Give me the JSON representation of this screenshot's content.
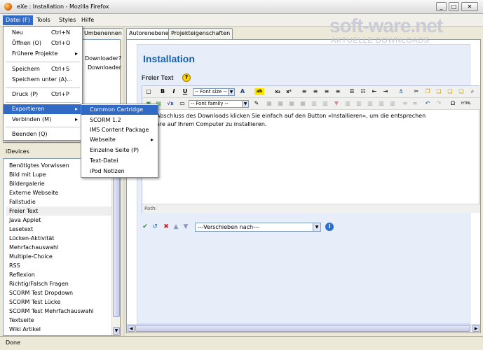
{
  "window": {
    "title": "eXe : Installation - Mozilla Firefox",
    "btn_min": "_",
    "btn_max": "□",
    "btn_close": "✕"
  },
  "menubar": [
    "Datei (F)",
    "Tools",
    "Styles",
    "Hilfe"
  ],
  "left_tabs": {
    "rename": "Umbenennen"
  },
  "outline": {
    "items": [
      "Downloader?",
      "Downloader"
    ]
  },
  "idevices": {
    "header": "iDevices",
    "items": [
      "Benötigtes Vorwissen",
      "Bild mit Lupe",
      "Bildergalerie",
      "Externe Webseite",
      "Fallstudie",
      "Freier Text",
      "Java Applet",
      "Lesetext",
      "Lücken-Aktivität",
      "Mehrfachauswahl",
      "Multiple-Choice",
      "RSS",
      "Reflexion",
      "Richtig/Falsch Fragen",
      "SCORM Test Dropdown",
      "SCORM Test Lücke",
      "SCORM Test Mehrfachauswahl",
      "Textseite",
      "Wiki Artikel"
    ]
  },
  "right_tabs": [
    "Autorenebene",
    "Projekteigenschaften"
  ],
  "page": {
    "title": "Installation",
    "block_title": "Freier Text",
    "help": "?"
  },
  "editor": {
    "font_size": "-- Font size --",
    "font_family": "-- Font family --",
    "text_line1": "Abschluss des Downloads klicken Sie einfach auf den Button »Installieren«, um die entsprechen",
    "text_line2": "are auf Ihrem Computer zu installieren.",
    "path_label": "Path:"
  },
  "toolbar": {
    "bold": "B",
    "italic": "I",
    "underline": "U",
    "sub": "x₂",
    "sup": "x²",
    "fontcolor": "A",
    "highlight": "ab",
    "omega": "Ω",
    "html": "HTML"
  },
  "actions": {
    "move_select": "---Verschieben nach---",
    "info": "i"
  },
  "file_menu": {
    "items": [
      {
        "label": "Neu",
        "shortcut": "Ctrl+N"
      },
      {
        "label": "Öffnen (O)",
        "shortcut": "Ctrl+O"
      },
      {
        "label": "Frühere Projekte",
        "submenu": "▸"
      },
      {
        "label": "Speichern",
        "shortcut": "Ctrl+S"
      },
      {
        "label": "Speichern unter (A)...",
        "shortcut": ""
      },
      {
        "label": "Druck (P)",
        "shortcut": "Ctrl+P"
      },
      {
        "label": "Exportieren",
        "submenu": "▸"
      },
      {
        "label": "Verbinden (M)",
        "submenu": "▸"
      },
      {
        "label": "Beenden (Q)",
        "shortcut": ""
      }
    ]
  },
  "export_menu": {
    "items": [
      "Common Cartridge",
      "SCORM 1.2",
      "IMS Content Package",
      "Webseite",
      "Einzelne Seite (P)",
      "Text-Datei",
      "iPod Notizen"
    ],
    "webseite_arrow": "▸"
  },
  "status": "Done",
  "watermark": {
    "brand": "soft-ware.net",
    "tagline": "AKTUELLE DOWNLOADS"
  },
  "colors": {
    "accent": "#316ac5",
    "title_blue": "#1b5fa8"
  }
}
